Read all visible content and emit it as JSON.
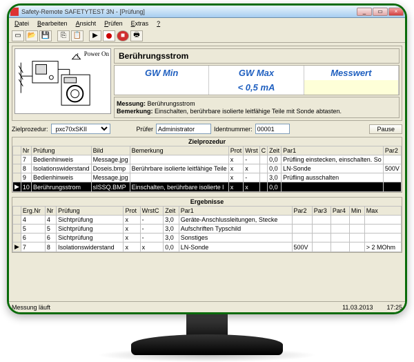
{
  "window": {
    "title": "Safety-Remote SAFETYTEST 3N - [Prüfung]"
  },
  "menu": {
    "m1": "Datei",
    "m2": "Bearbeiten",
    "m3": "Ansicht",
    "m4": "Prüfen",
    "m5": "Extras",
    "m6": "?"
  },
  "diagram": {
    "poweron": "Power On"
  },
  "meas": {
    "title": "Berührungsstrom",
    "h1": "GW Min",
    "h2": "GW Max",
    "h3": "Messwert",
    "v1": "",
    "v2": "< 0,5 mA",
    "v3": ""
  },
  "info": {
    "l1": "Messung:",
    "v1": "Berührungsstrom",
    "l2": "Bemerkung:",
    "v2": "Einschalten, berührbare isolierte leitfähige Teile mit Sonde abtasten."
  },
  "params": {
    "zp_l": "Zielprozedur:",
    "zp_v": "pxc70xSKII",
    "pr_l": "Prüfer",
    "pr_v": "Administrator",
    "id_l": "Identnummer:",
    "id_v": "00001",
    "pause": "Pause"
  },
  "zp": {
    "title": "Zielprozedur",
    "hdr": [
      "",
      "Nr",
      "Prüfung",
      "Bild",
      "Bemerkung",
      "Prot",
      "Wrst",
      "C",
      "Zeit",
      "Par1",
      "Par2"
    ],
    "rows": [
      {
        "m": "",
        "nr": "7",
        "p": "Bedienhinweis",
        "b": "Message.jpg",
        "bm": "",
        "pr": "x",
        "w": "-",
        "c": "",
        "z": "0,0",
        "p1": "Prüfling einstecken, einschalten. So",
        "p2": ""
      },
      {
        "m": "",
        "nr": "8",
        "p": "Isolationswiderstand",
        "b": "Doseis.bmp",
        "bm": "Berührbare isolierte leitfähige Teile",
        "pr": "x",
        "w": "x",
        "c": "",
        "z": "0,0",
        "p1": "LN-Sonde",
        "p2": "500V"
      },
      {
        "m": "",
        "nr": "9",
        "p": "Bedienhinweis",
        "b": "Message.jpg",
        "bm": "",
        "pr": "x",
        "w": "-",
        "c": "",
        "z": "3,0",
        "p1": "Prüfling ausschalten",
        "p2": ""
      },
      {
        "m": "▶",
        "nr": "10",
        "p": "Berührungsstrom",
        "b": "sISSQ.BMP",
        "bm": "Einschalten, berührbare isolierte l",
        "pr": "x",
        "w": "x",
        "c": "",
        "z": "0,0",
        "p1": "",
        "p2": "",
        "sel": true
      }
    ]
  },
  "erg": {
    "title": "Ergebnisse",
    "hdr": [
      "",
      "Erg.Nr",
      "Nr",
      "Prüfung",
      "Prot",
      "WrstC",
      "Zeit",
      "Par1",
      "Par2",
      "Par3",
      "Par4",
      "Min",
      "Max"
    ],
    "rows": [
      {
        "m": "",
        "en": "4",
        "nr": "4",
        "p": "Sichtprüfung",
        "pr": "x",
        "w": "-",
        "z": "3,0",
        "p1": "Geräte-Anschlussleitungen, Stecke",
        "p2": "",
        "p3": "",
        "p4": "",
        "mn": "",
        "mx": ""
      },
      {
        "m": "",
        "en": "5",
        "nr": "5",
        "p": "Sichtprüfung",
        "pr": "x",
        "w": "-",
        "z": "3,0",
        "p1": "Aufschriften Typschild",
        "p2": "",
        "p3": "",
        "p4": "",
        "mn": "",
        "mx": ""
      },
      {
        "m": "",
        "en": "6",
        "nr": "6",
        "p": "Sichtprüfung",
        "pr": "x",
        "w": "-",
        "z": "3,0",
        "p1": "Sonstiges",
        "p2": "",
        "p3": "",
        "p4": "",
        "mn": "",
        "mx": ""
      },
      {
        "m": "▶",
        "en": "7",
        "nr": "8",
        "p": "Isolationswiderstand",
        "pr": "x",
        "w": "x",
        "z": "0,0",
        "p1": "LN-Sonde",
        "p2": "500V",
        "p3": "",
        "p4": "",
        "mn": "",
        "mx": "> 2 MOhm"
      }
    ]
  },
  "status": {
    "msg": "Messung läuft",
    "date": "11.03.2013",
    "time": "17:25"
  }
}
